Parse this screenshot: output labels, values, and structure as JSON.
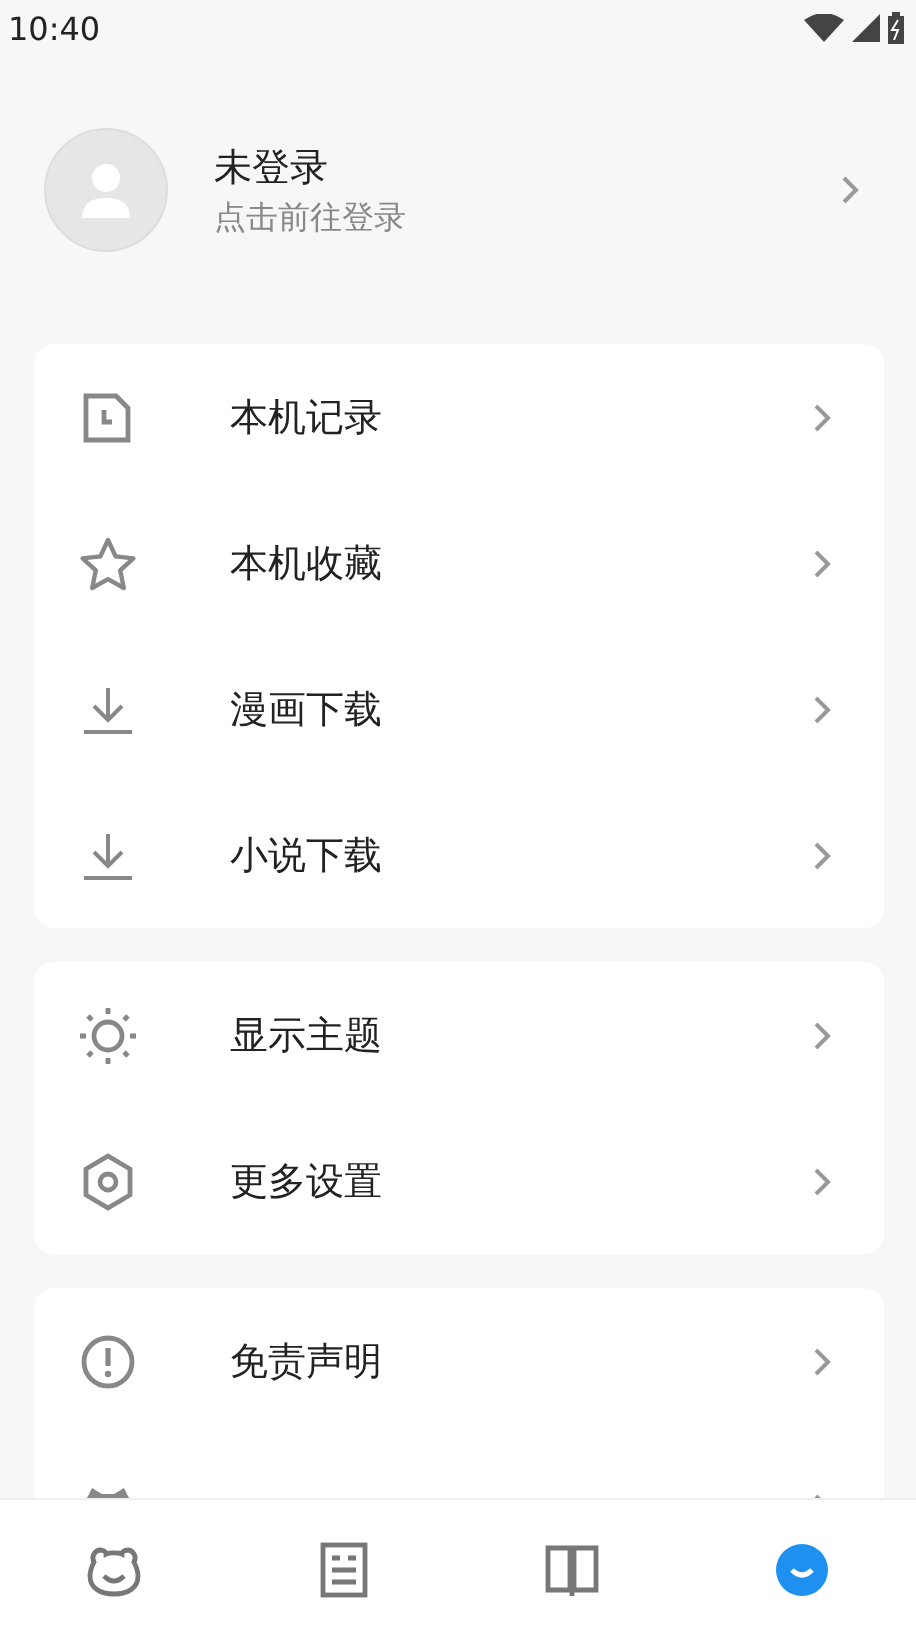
{
  "status_bar": {
    "time": "10:40"
  },
  "profile": {
    "name": "未登录",
    "subtitle": "点击前往登录"
  },
  "sections": [
    {
      "items": [
        {
          "label": "本机记录"
        },
        {
          "label": "本机收藏"
        },
        {
          "label": "漫画下载"
        },
        {
          "label": "小说下载"
        }
      ]
    },
    {
      "items": [
        {
          "label": "显示主题"
        },
        {
          "label": "更多设置"
        }
      ]
    },
    {
      "items": [
        {
          "label": "免责声明"
        }
      ]
    }
  ],
  "bottom_nav": [
    {
      "selected": false
    },
    {
      "selected": false
    },
    {
      "selected": false
    },
    {
      "selected": true
    }
  ]
}
